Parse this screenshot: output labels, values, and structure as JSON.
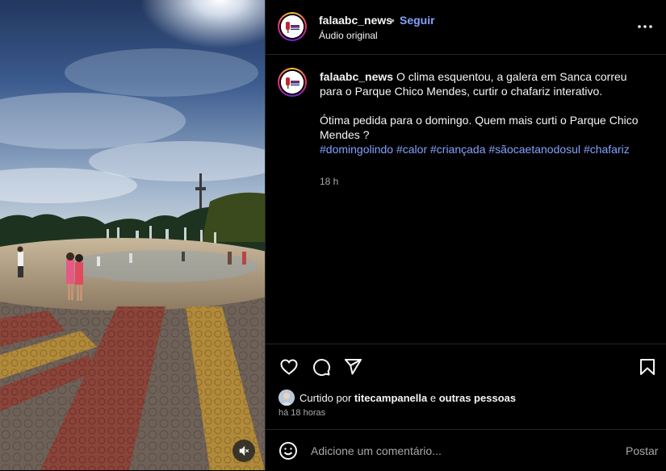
{
  "post": {
    "username": "falaabc_news",
    "separator": "•",
    "follow_label": "Seguir",
    "audio_label": "Áudio original",
    "more_icon": "more-horizontal-icon"
  },
  "caption": {
    "username": "falaabc_news",
    "text": " O clima esquentou, a galera em Sanca correu para o Parque Chico Mendes, curtir o chafariz interativo.",
    "text2": "Ótima pedida para o domingo. Quem mais curti o Parque Chico Mendes ?",
    "hashtags": [
      "#domingolindo",
      "#calor",
      "#criançada",
      "#sãocaetanodosul",
      "#chafariz"
    ],
    "age": "18 h"
  },
  "actions": {
    "like_icon": "heart-icon",
    "comment_icon": "comment-icon",
    "share_icon": "send-icon",
    "save_icon": "bookmark-icon"
  },
  "likes": {
    "prefix": "Curtido por ",
    "user": "titecampanella",
    "middle": " e ",
    "others": "outras pessoas"
  },
  "time_ago": "há 18 horas",
  "comment": {
    "placeholder": "Adicione um comentário...",
    "post_label": "Postar",
    "emoji_icon": "emoji-icon"
  },
  "media": {
    "mute_icon": "muted-speaker-icon"
  },
  "colors": {
    "background": "#000000",
    "link": "#85a1ff",
    "muted": "#a8a8a8",
    "text": "#f5f5f5"
  }
}
